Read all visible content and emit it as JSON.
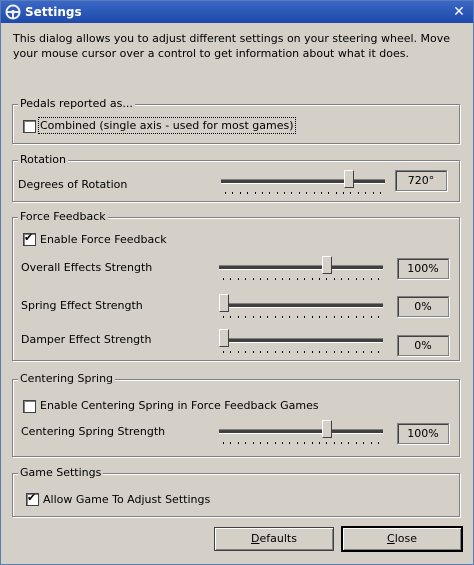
{
  "window": {
    "title": "Settings",
    "icon": "steering-wheel-icon",
    "close_glyph": "✕"
  },
  "description": "This dialog allows you to adjust different settings on your steering wheel.  Move your mouse cursor over a control to get information about what it does.",
  "pedals": {
    "group_title": "Pedals reported as...",
    "combined_label": "Combined (single axis - used for most games)",
    "combined_checked": false
  },
  "rotation": {
    "group_title": "Rotation",
    "degrees_label": "Degrees of Rotation",
    "degrees_value": "720°",
    "degrees_fraction": 0.8
  },
  "force_feedback": {
    "group_title": "Force Feedback",
    "enable_label": "Enable Force Feedback",
    "enable_checked": true,
    "overall_label": "Overall Effects Strength",
    "overall_value": "100%",
    "overall_fraction": 0.67,
    "spring_label": "Spring Effect Strength",
    "spring_value": "0%",
    "spring_fraction": 0,
    "damper_label": "Damper Effect Strength",
    "damper_value": "0%",
    "damper_fraction": 0
  },
  "centering_spring": {
    "group_title": "Centering Spring",
    "enable_label": "Enable Centering Spring in Force Feedback Games",
    "enable_checked": false,
    "strength_label": "Centering Spring Strength",
    "strength_value": "100%",
    "strength_fraction": 0.67
  },
  "game_settings": {
    "group_title": "Game Settings",
    "allow_label": "Allow Game To Adjust Settings",
    "allow_checked": true
  },
  "buttons": {
    "defaults_label": "Defaults",
    "close_label": "Close"
  }
}
